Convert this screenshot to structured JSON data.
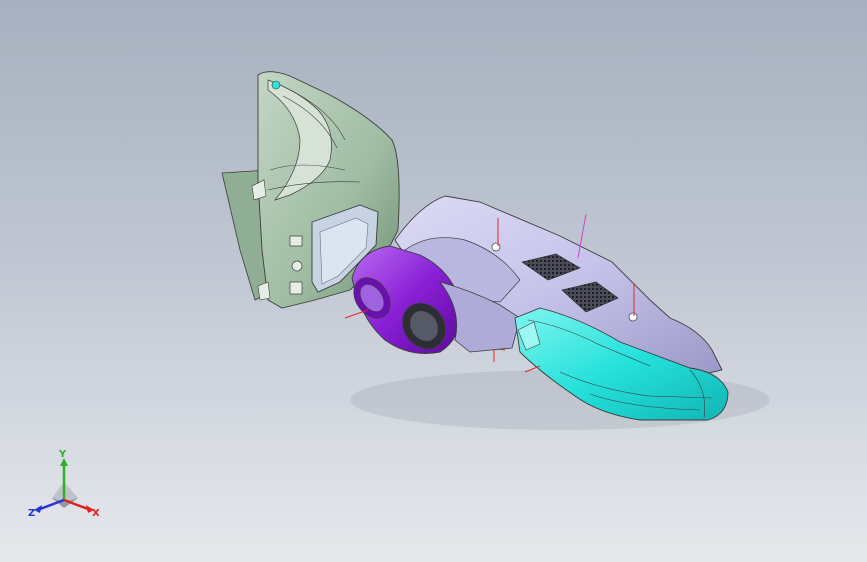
{
  "viewport": {
    "background_top": "#a7b0bf",
    "background_bottom": "#e6e8ec"
  },
  "model": {
    "parts": [
      {
        "name": "housing-front-bezel",
        "color": "#a3bfa6"
      },
      {
        "name": "handle-upper-shell",
        "color": "#c9c6ec"
      },
      {
        "name": "barrel-ring",
        "color": "#8a1fd6"
      },
      {
        "name": "grip-cover",
        "color": "#25e0da"
      }
    ],
    "vent_grilles": 2,
    "screw_holes": 2
  },
  "triad": {
    "x_label": "X",
    "y_label": "Y",
    "z_label": "Z",
    "x_color": "#e0201e",
    "y_color": "#2fae2f",
    "z_color": "#2433d6"
  }
}
